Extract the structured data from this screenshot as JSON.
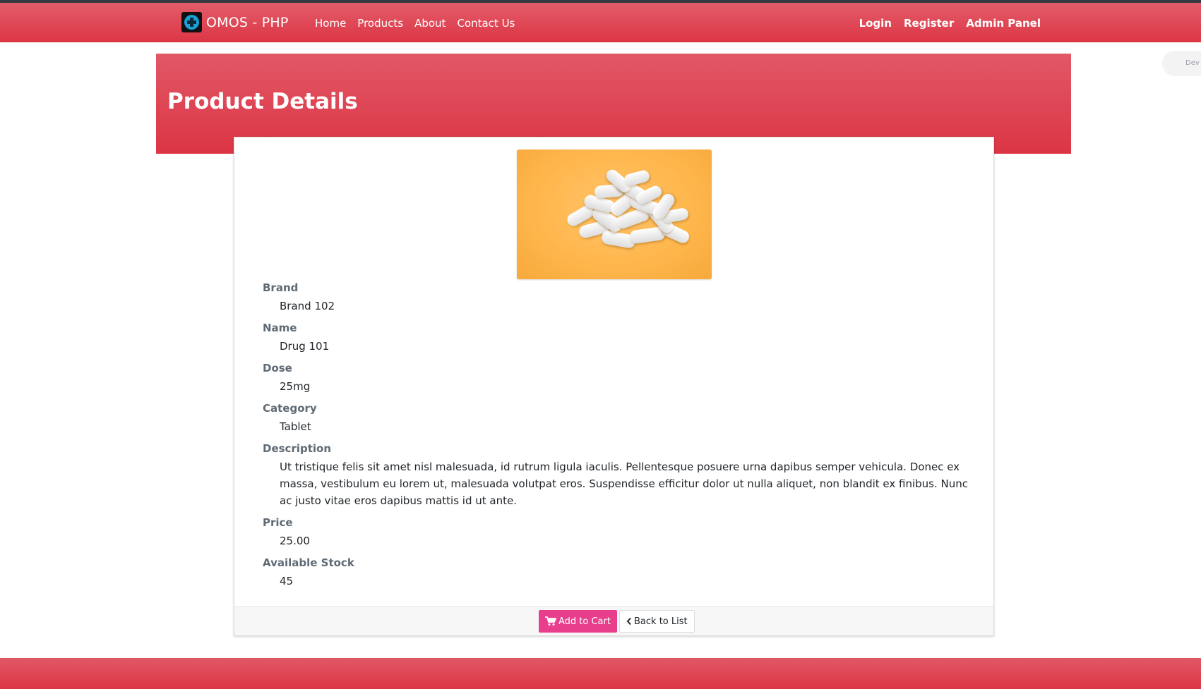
{
  "navbar": {
    "brand": "OMOS - PHP",
    "links": [
      "Home",
      "Products",
      "About",
      "Contact Us"
    ],
    "right_links": [
      "Login",
      "Register",
      "Admin Panel"
    ]
  },
  "dev_pill": "Dev",
  "page": {
    "title": "Product Details"
  },
  "product": {
    "fields": [
      {
        "label": "Brand",
        "value": "Brand 102"
      },
      {
        "label": "Name",
        "value": "Drug 101"
      },
      {
        "label": "Dose",
        "value": "25mg"
      },
      {
        "label": "Category",
        "value": "Tablet"
      },
      {
        "label": "Description",
        "value": "Ut tristique felis sit amet nisl malesuada, id rutrum ligula iaculis. Pellentesque posuere urna dapibus semper vehicula. Donec ex massa, vestibulum eu lorem ut, malesuada volutpat eros. Suspendisse efficitur dolor ut nulla aliquet, non blandit ex finibus. Nunc ac justo vitae eros dapibus mattis id ut ante."
      },
      {
        "label": "Price",
        "value": "25.00"
      },
      {
        "label": "Available Stock",
        "value": "45"
      }
    ]
  },
  "actions": {
    "add_to_cart": "Add to Cart",
    "back_to_list": "Back to List"
  },
  "colors": {
    "primary": "#dc3545",
    "cart_button": "#e83e8c"
  }
}
